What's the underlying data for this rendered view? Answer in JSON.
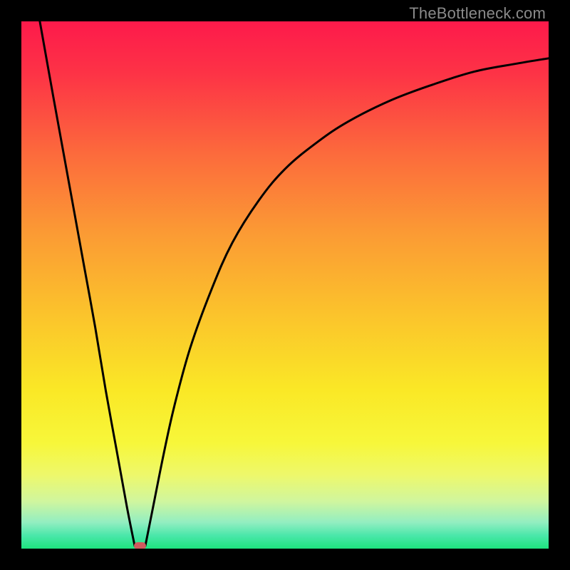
{
  "watermark": "TheBottleneck.com",
  "colors": {
    "frame": "#000000",
    "gradient_stops": [
      {
        "offset": 0.0,
        "color": "#fd1a4b"
      },
      {
        "offset": 0.1,
        "color": "#fd3346"
      },
      {
        "offset": 0.25,
        "color": "#fc6a3c"
      },
      {
        "offset": 0.4,
        "color": "#fb9a34"
      },
      {
        "offset": 0.55,
        "color": "#fbc22c"
      },
      {
        "offset": 0.7,
        "color": "#fae826"
      },
      {
        "offset": 0.8,
        "color": "#f7f73a"
      },
      {
        "offset": 0.86,
        "color": "#eef86b"
      },
      {
        "offset": 0.91,
        "color": "#d0f69e"
      },
      {
        "offset": 0.95,
        "color": "#93eec1"
      },
      {
        "offset": 0.975,
        "color": "#4ae7aa"
      },
      {
        "offset": 1.0,
        "color": "#1ee47e"
      }
    ],
    "curve": "#000000",
    "marker": "#cf5a5e"
  },
  "chart_data": {
    "type": "line",
    "title": "",
    "xlabel": "",
    "ylabel": "",
    "xlim": [
      0,
      100
    ],
    "ylim": [
      0,
      100
    ],
    "grid": false,
    "series": [
      {
        "name": "left-branch",
        "x": [
          3.5,
          6,
          8,
          10,
          12,
          14,
          16,
          18,
          20,
          21.5
        ],
        "y": [
          100,
          86,
          75,
          64,
          53,
          42,
          30,
          19,
          8,
          0.5
        ]
      },
      {
        "name": "right-branch",
        "x": [
          23.5,
          25,
          27,
          29,
          32,
          36,
          40,
          45,
          50,
          56,
          62,
          70,
          78,
          86,
          94,
          100
        ],
        "y": [
          0.5,
          8,
          18,
          27,
          38,
          49,
          58,
          66,
          72,
          77,
          81,
          85,
          88,
          90.5,
          92,
          93
        ]
      }
    ],
    "marker": {
      "x": 22.5,
      "y": 0.5,
      "w": 2.2,
      "h": 1.3
    },
    "notes": "V-shaped bottleneck curve against vertical rainbow gradient (red top → green bottom). Minimum at ≈22.5% on x-axis near y≈0."
  }
}
